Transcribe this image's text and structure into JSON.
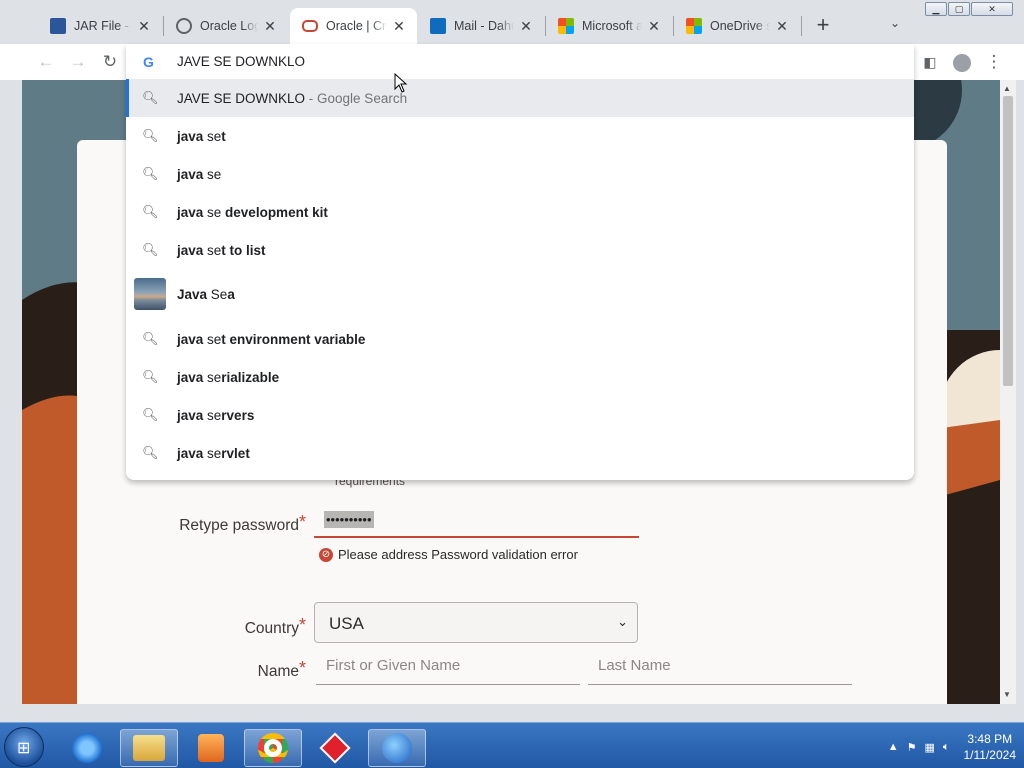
{
  "tabs": [
    {
      "title": "JAR File - W",
      "favicon": "word-doc-icon",
      "color": "#2b579a"
    },
    {
      "title": "Oracle Login",
      "favicon": "globe-icon",
      "color": "#5f6368"
    },
    {
      "title": "Oracle | Cre",
      "favicon": "oracle-icon",
      "color": "#c74634",
      "active": true
    },
    {
      "title": "Mail - Dahu",
      "favicon": "outlook-icon",
      "color": "#0f6cbd"
    },
    {
      "title": "Microsoft ac",
      "favicon": "microsoft-icon",
      "color": "#f25022"
    },
    {
      "title": "OneDrive sy",
      "favicon": "microsoft-icon",
      "color": "#f25022"
    }
  ],
  "omnibox": {
    "query": "JAVE SE DOWNKLO",
    "suggestions": [
      {
        "icon": "search",
        "bold_prefix": "",
        "text": "JAVE SE DOWNKLO",
        "suffix": " - Google Search",
        "selected": true
      },
      {
        "icon": "search",
        "bold_prefix": "java",
        "mid": " se",
        "bold_rest": "t"
      },
      {
        "icon": "search",
        "bold_prefix": "java",
        "mid": " se",
        "bold_rest": ""
      },
      {
        "icon": "search",
        "bold_prefix": "java",
        "mid": " se",
        "bold_rest": " development kit"
      },
      {
        "icon": "search",
        "bold_prefix": "java",
        "mid": " se",
        "bold_rest": "t to list"
      },
      {
        "icon": "thumbnail",
        "bold_prefix": "Java",
        "mid": " Se",
        "bold_rest": "a"
      },
      {
        "icon": "search",
        "bold_prefix": "java",
        "mid": " se",
        "bold_rest": "t environment variable"
      },
      {
        "icon": "search",
        "bold_prefix": "java",
        "mid": " se",
        "bold_rest": "rializable"
      },
      {
        "icon": "search",
        "bold_prefix": "java",
        "mid": " se",
        "bold_rest": "rvers"
      },
      {
        "icon": "search",
        "bold_prefix": "java",
        "mid": " se",
        "bold_rest": "rvlet"
      }
    ]
  },
  "form": {
    "hint_text": "requirements",
    "retype_label": "Retype password",
    "retype_value": "••••••••••",
    "error_text": "Please address Password validation error",
    "country_label": "Country",
    "country_value": "USA",
    "name_label": "Name",
    "first_placeholder": "First or Given Name",
    "last_placeholder": "Last Name",
    "required_mark": "*"
  },
  "taskbar": {
    "time": "3:48 PM",
    "date": "1/11/2024"
  },
  "colors": {
    "accent": "#1a73e8",
    "oracle_red": "#c74634"
  }
}
